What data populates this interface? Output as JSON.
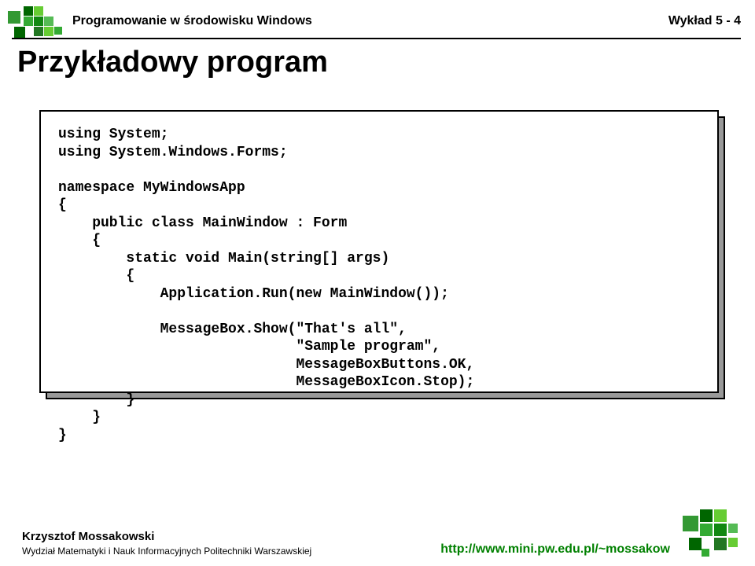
{
  "header": {
    "course_title": "Programowanie w środowisku Windows",
    "lecture_label": "Wykład 5 - 4"
  },
  "slide": {
    "title": "Przykładowy program"
  },
  "code": {
    "lines": [
      "using System;",
      "using System.Windows.Forms;",
      "",
      "namespace MyWindowsApp",
      "{",
      "    public class MainWindow : Form",
      "    {",
      "        static void Main(string[] args)",
      "        {",
      "            Application.Run(new MainWindow());",
      "",
      "            MessageBox.Show(\"That's all\",",
      "                            \"Sample program\",",
      "                            MessageBoxButtons.OK,",
      "                            MessageBoxIcon.Stop);",
      "        }",
      "    }",
      "}"
    ]
  },
  "footer": {
    "author": "Krzysztof Mossakowski",
    "affiliation": "Wydział Matematyki i Nauk Informacyjnych Politechniki Warszawskiej",
    "url": "http://www.mini.pw.edu.pl/~mossakow"
  }
}
